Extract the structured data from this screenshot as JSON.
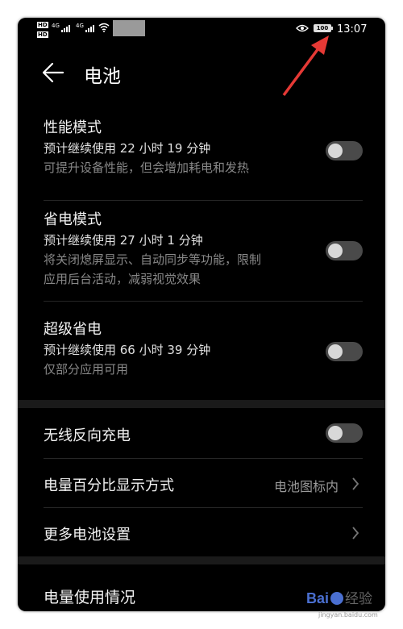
{
  "status_bar": {
    "hd1": "HD",
    "hd2": "HD",
    "signal1": "4G",
    "signal2": "4G",
    "battery": "100",
    "time": "13:07"
  },
  "header": {
    "title": "电池"
  },
  "modes": [
    {
      "title": "性能模式",
      "estimate": "预计继续使用 22 小时 19 分钟",
      "desc1": "可提升设备性能，但会增加耗电和发热",
      "desc2": "",
      "on": false
    },
    {
      "title": "省电模式",
      "estimate": "预计继续使用 27 小时 1 分钟",
      "desc1": "将关闭熄屏显示、自动同步等功能，限制",
      "desc2": "应用后台活动，减弱视觉效果",
      "on": false
    },
    {
      "title": "超级省电",
      "estimate": "预计继续使用 66 小时 39 分钟",
      "desc1": "仅部分应用可用",
      "desc2": "",
      "on": false
    }
  ],
  "settings": {
    "reverse_charge": {
      "label": "无线反向充电",
      "on": false
    },
    "percent_display": {
      "label": "电量百分比显示方式",
      "value": "电池图标内"
    },
    "more": {
      "label": "更多电池设置"
    }
  },
  "usage": {
    "title": "电量使用情况"
  },
  "watermark": {
    "brand": "Bai",
    "brand2": "百度",
    "jingyan": "经验",
    "url": "jingyan.baidu.com"
  },
  "colors": {
    "background": "#000000",
    "annotation_arrow": "#e53935",
    "toggle_off": "#4a4a4a"
  }
}
